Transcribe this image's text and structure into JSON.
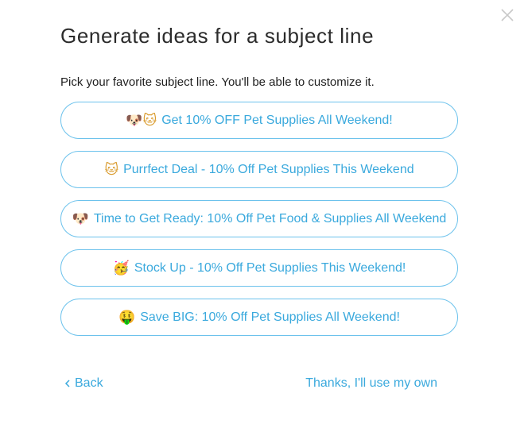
{
  "dialog": {
    "title": "Generate ideas for a subject line",
    "instructions": "Pick your favorite subject line. You'll be able to customize it.",
    "close_icon": "close-icon"
  },
  "options": [
    {
      "emoji": "🐶🐱",
      "label": "Get 10% OFF Pet Supplies All Weekend!"
    },
    {
      "emoji": "🐱",
      "label": "Purrfect Deal - 10% Off Pet Supplies This Weekend"
    },
    {
      "emoji": "🐶",
      "label": "Time to Get Ready: 10% Off Pet Food & Supplies All Weekend"
    },
    {
      "emoji": "🥳",
      "label": "Stock Up - 10% Off Pet Supplies This Weekend!"
    },
    {
      "emoji": "🤑",
      "label": "Save BIG: 10% Off Pet Supplies All Weekend!"
    }
  ],
  "footer": {
    "back_label": "Back",
    "own_label": "Thanks, I'll use my own"
  },
  "colors": {
    "accent": "#3aa9dd",
    "border": "#6cc2ec",
    "title": "#2b2b2b"
  }
}
